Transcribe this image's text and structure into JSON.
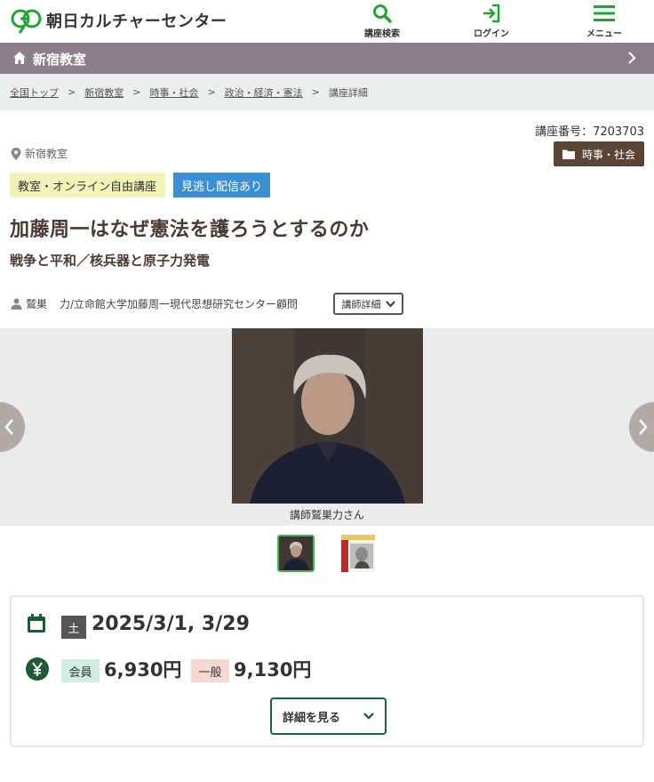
{
  "header": {
    "logo_text": "朝日カルチャーセンター",
    "search_label": "講座検索",
    "login_label": "ログイン",
    "menu_label": "メニュー",
    "accent_color": "#21a335"
  },
  "classroom_bar": {
    "name": "新宿教室",
    "bg_color": "#8c7f8b"
  },
  "breadcrumb": {
    "items": [
      "全国トップ",
      "新宿教室",
      "時事・社会",
      "政治・経済・憲法"
    ],
    "current": "講座詳細",
    "separator": ">"
  },
  "course": {
    "number": "講座番号：7203703",
    "location": "新宿教室",
    "category": "時事・社会",
    "tags": [
      "教室・オンライン自由講座",
      "見逃し配信あり"
    ],
    "title": "加藤周一はなぜ憲法を護ろうとするのか",
    "subtitle": "戦争と平和／核兵器と原子力発電",
    "lecturer_name": "鷲巣",
    "lecturer_affiliation": "力/立命館大学加藤周一現代思想研究センター顧問",
    "lecturer_button": "講師詳細"
  },
  "gallery": {
    "caption": "講師鷲巣力さん",
    "thumbnail_count": 2,
    "active_thumbnail": 1
  },
  "schedule": {
    "day": "土",
    "dates": "2025/3/1, 3/29",
    "member_label": "会員",
    "member_price": "6,930円",
    "general_label": "一般",
    "general_price": "9,130円",
    "detail_button": "詳細を見る",
    "icon_color": "#1e5a33"
  }
}
